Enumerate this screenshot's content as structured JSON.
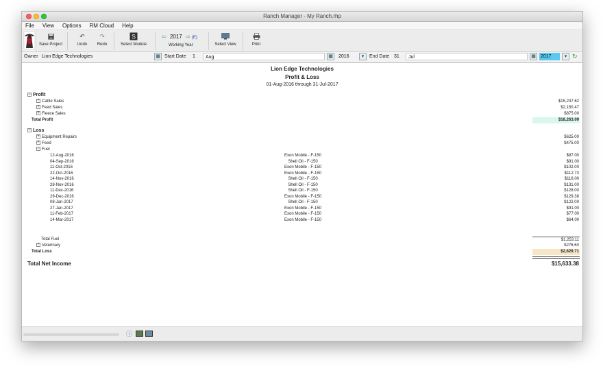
{
  "window": {
    "title": "Ranch Manager - My Ranch.rhp"
  },
  "menu": [
    "File",
    "View",
    "Options",
    "RM Cloud",
    "Help"
  ],
  "toolbar": {
    "save": "Save Project",
    "undo": "Undo",
    "redo": "Redo",
    "select_module": "Select Module",
    "working_year_label": "Working Year",
    "year": "2017",
    "edit": "(E)",
    "select_view": "Select View",
    "print": "Print"
  },
  "filter": {
    "owner_label": "Owner",
    "owner_value": "Lion Edge Technologies",
    "start_label": "Start Date",
    "start_day": "1",
    "start_month": "Aug",
    "start_year": "2016",
    "end_label": "End Date",
    "end_day": "31",
    "end_month": "Jul",
    "end_year": "2017"
  },
  "report": {
    "company": "Lion Edge Technologies",
    "title": "Profit & Loss",
    "period": "01-Aug-2016 through 31-Jul-2017",
    "profit_header": "Profit",
    "profit_items": [
      {
        "label": "Cattle Sales",
        "amount": "$15,237.62"
      },
      {
        "label": "Feed Sales",
        "amount": "$2,150.47"
      },
      {
        "label": "Fleece Sales",
        "amount": "$875.00"
      }
    ],
    "total_profit_label": "Total Profit",
    "total_profit": "$18,263.09",
    "loss_header": "Loss",
    "loss_items": [
      {
        "label": "Equipment Repairs",
        "amount": "$625.00"
      },
      {
        "label": "Feed",
        "amount": "$475.00"
      }
    ],
    "fuel_label": "Fuel",
    "fuel_rows": [
      {
        "date": "12-Aug-2016",
        "desc": "Exon Mobile - F-150",
        "amount": "$87.00"
      },
      {
        "date": "04-Sep-2016",
        "desc": "Shell Oil - F-150",
        "amount": "$91.00"
      },
      {
        "date": "11-Oct-2016",
        "desc": "Exon Mobile - F-150",
        "amount": "$102.00"
      },
      {
        "date": "22-Oct-2016",
        "desc": "Exon Mobile - F-150",
        "amount": "$112.73"
      },
      {
        "date": "14-Nov-2016",
        "desc": "Shell Oil - F-150",
        "amount": "$118.00"
      },
      {
        "date": "28-Nov-2016",
        "desc": "Shell Oil - F-150",
        "amount": "$131.00"
      },
      {
        "date": "11-Dec-2016",
        "desc": "Shell Oil - F-150",
        "amount": "$128.00"
      },
      {
        "date": "29-Dec-2016",
        "desc": "Exon Mobile - F-150",
        "amount": "$129.38"
      },
      {
        "date": "08-Jan-2017",
        "desc": "Shell Oil - F-150",
        "amount": "$122.00"
      },
      {
        "date": "27-Jan-2017",
        "desc": "Exon Mobile - F-150",
        "amount": "$91.00"
      },
      {
        "date": "11-Feb-2017",
        "desc": "Exon Mobile - F-150",
        "amount": "$77.00"
      },
      {
        "date": "14-Mar-2017",
        "desc": "Exon Mobile - F-150",
        "amount": "$64.00"
      }
    ],
    "total_fuel_label": "Total Fuel",
    "total_fuel": "$1,253.11",
    "veterinary_label": "Veterinary",
    "veterinary_amount": "$276.60",
    "total_loss_label": "Total Loss",
    "total_loss": "$2,629.71",
    "net_label": "Total Net Income",
    "net_amount": "$15,633.38"
  },
  "colors": {
    "profit_total_bg": "#d9f7ee",
    "loss_total_bg": "#f7e7c7",
    "year_highlight": "#5ac8f0"
  }
}
